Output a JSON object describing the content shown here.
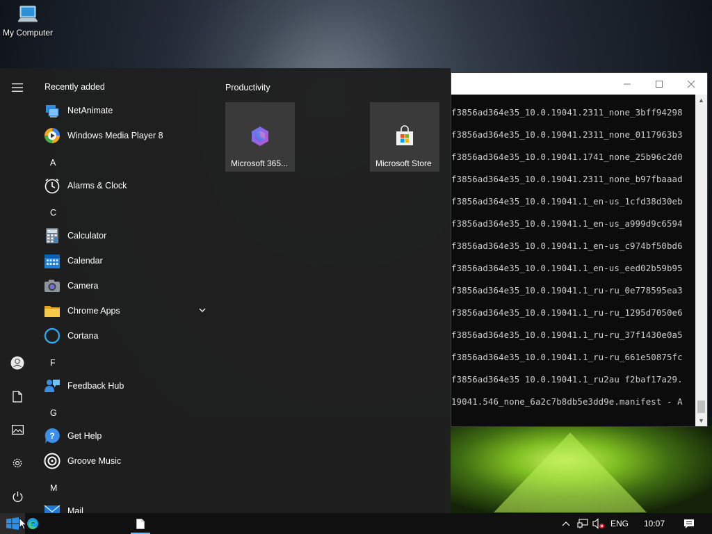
{
  "desktop": {
    "icons": [
      {
        "label": "My Computer",
        "icon": "computer-icon"
      }
    ]
  },
  "console": {
    "lines": [
      "f3856ad364e35_10.0.19041.2311_none_3bff94298",
      "f3856ad364e35_10.0.19041.2311_none_0117963b3",
      "f3856ad364e35_10.0.19041.1741_none_25b96c2d0",
      "f3856ad364e35_10.0.19041.2311_none_b97fbaaad",
      "f3856ad364e35_10.0.19041.1_en-us_1cfd38d30eb",
      "f3856ad364e35_10.0.19041.1_en-us_a999d9c6594",
      "f3856ad364e35_10.0.19041.1_en-us_c974bf50bd6",
      "f3856ad364e35_10.0.19041.1_en-us_eed02b59b95",
      "f3856ad364e35_10.0.19041.1_ru-ru_0e778595ea3",
      "f3856ad364e35_10.0.19041.1_ru-ru_1295d7050e6",
      "f3856ad364e35_10.0.19041.1_ru-ru_37f1430e0a5",
      "f3856ad364e35_10.0.19041.1_ru-ru_661e50875fc",
      "f3856ad364e35 10.0.19041.1_ru2au f2baf17a29.",
      "19041.546_none_6a2c7b8db5e3dd9e.manifest - A"
    ]
  },
  "start_menu": {
    "list_heading": "Recently added",
    "recent": [
      {
        "label": "NetAnimate",
        "icon": "netanimate-icon"
      },
      {
        "label": "Windows Media Player 8",
        "icon": "media-player-icon"
      }
    ],
    "sections": [
      {
        "letter": "A",
        "apps": [
          {
            "label": "Alarms & Clock",
            "icon": "alarm-clock-icon"
          }
        ]
      },
      {
        "letter": "C",
        "apps": [
          {
            "label": "Calculator",
            "icon": "calculator-icon"
          },
          {
            "label": "Calendar",
            "icon": "calendar-icon"
          },
          {
            "label": "Camera",
            "icon": "camera-icon"
          },
          {
            "label": "Chrome Apps",
            "icon": "folder-icon",
            "expandable": true
          },
          {
            "label": "Cortana",
            "icon": "cortana-icon"
          }
        ]
      },
      {
        "letter": "F",
        "apps": [
          {
            "label": "Feedback Hub",
            "icon": "feedback-hub-icon"
          }
        ]
      },
      {
        "letter": "G",
        "apps": [
          {
            "label": "Get Help",
            "icon": "get-help-icon"
          },
          {
            "label": "Groove Music",
            "icon": "groove-music-icon"
          }
        ]
      },
      {
        "letter": "M",
        "apps": [
          {
            "label": "Mail",
            "icon": "mail-icon"
          }
        ]
      }
    ],
    "rail": [
      "hamburger-icon",
      "user-icon",
      "documents-icon",
      "pictures-icon",
      "settings-icon",
      "power-icon"
    ],
    "tile_group": {
      "label": "Productivity",
      "tiles": [
        {
          "label": "Microsoft 365...",
          "icon": "microsoft-365-icon"
        },
        {
          "label": "Microsoft Store",
          "icon": "microsoft-store-icon"
        }
      ]
    }
  },
  "taskbar": {
    "language": "ENG",
    "time": "10:07",
    "items": [
      "start-icon",
      "edge-icon",
      "file-icon"
    ],
    "tray": [
      "chevron-up-icon",
      "network-icon",
      "volume-muted-icon",
      "action-center-icon"
    ]
  },
  "colors": {
    "menu_bg": "#1f1f1f",
    "tile_bg": "#3a3a3a",
    "taskbar_bg": "#101010",
    "accent": "#0078d4",
    "console_text": "#cccccc"
  }
}
